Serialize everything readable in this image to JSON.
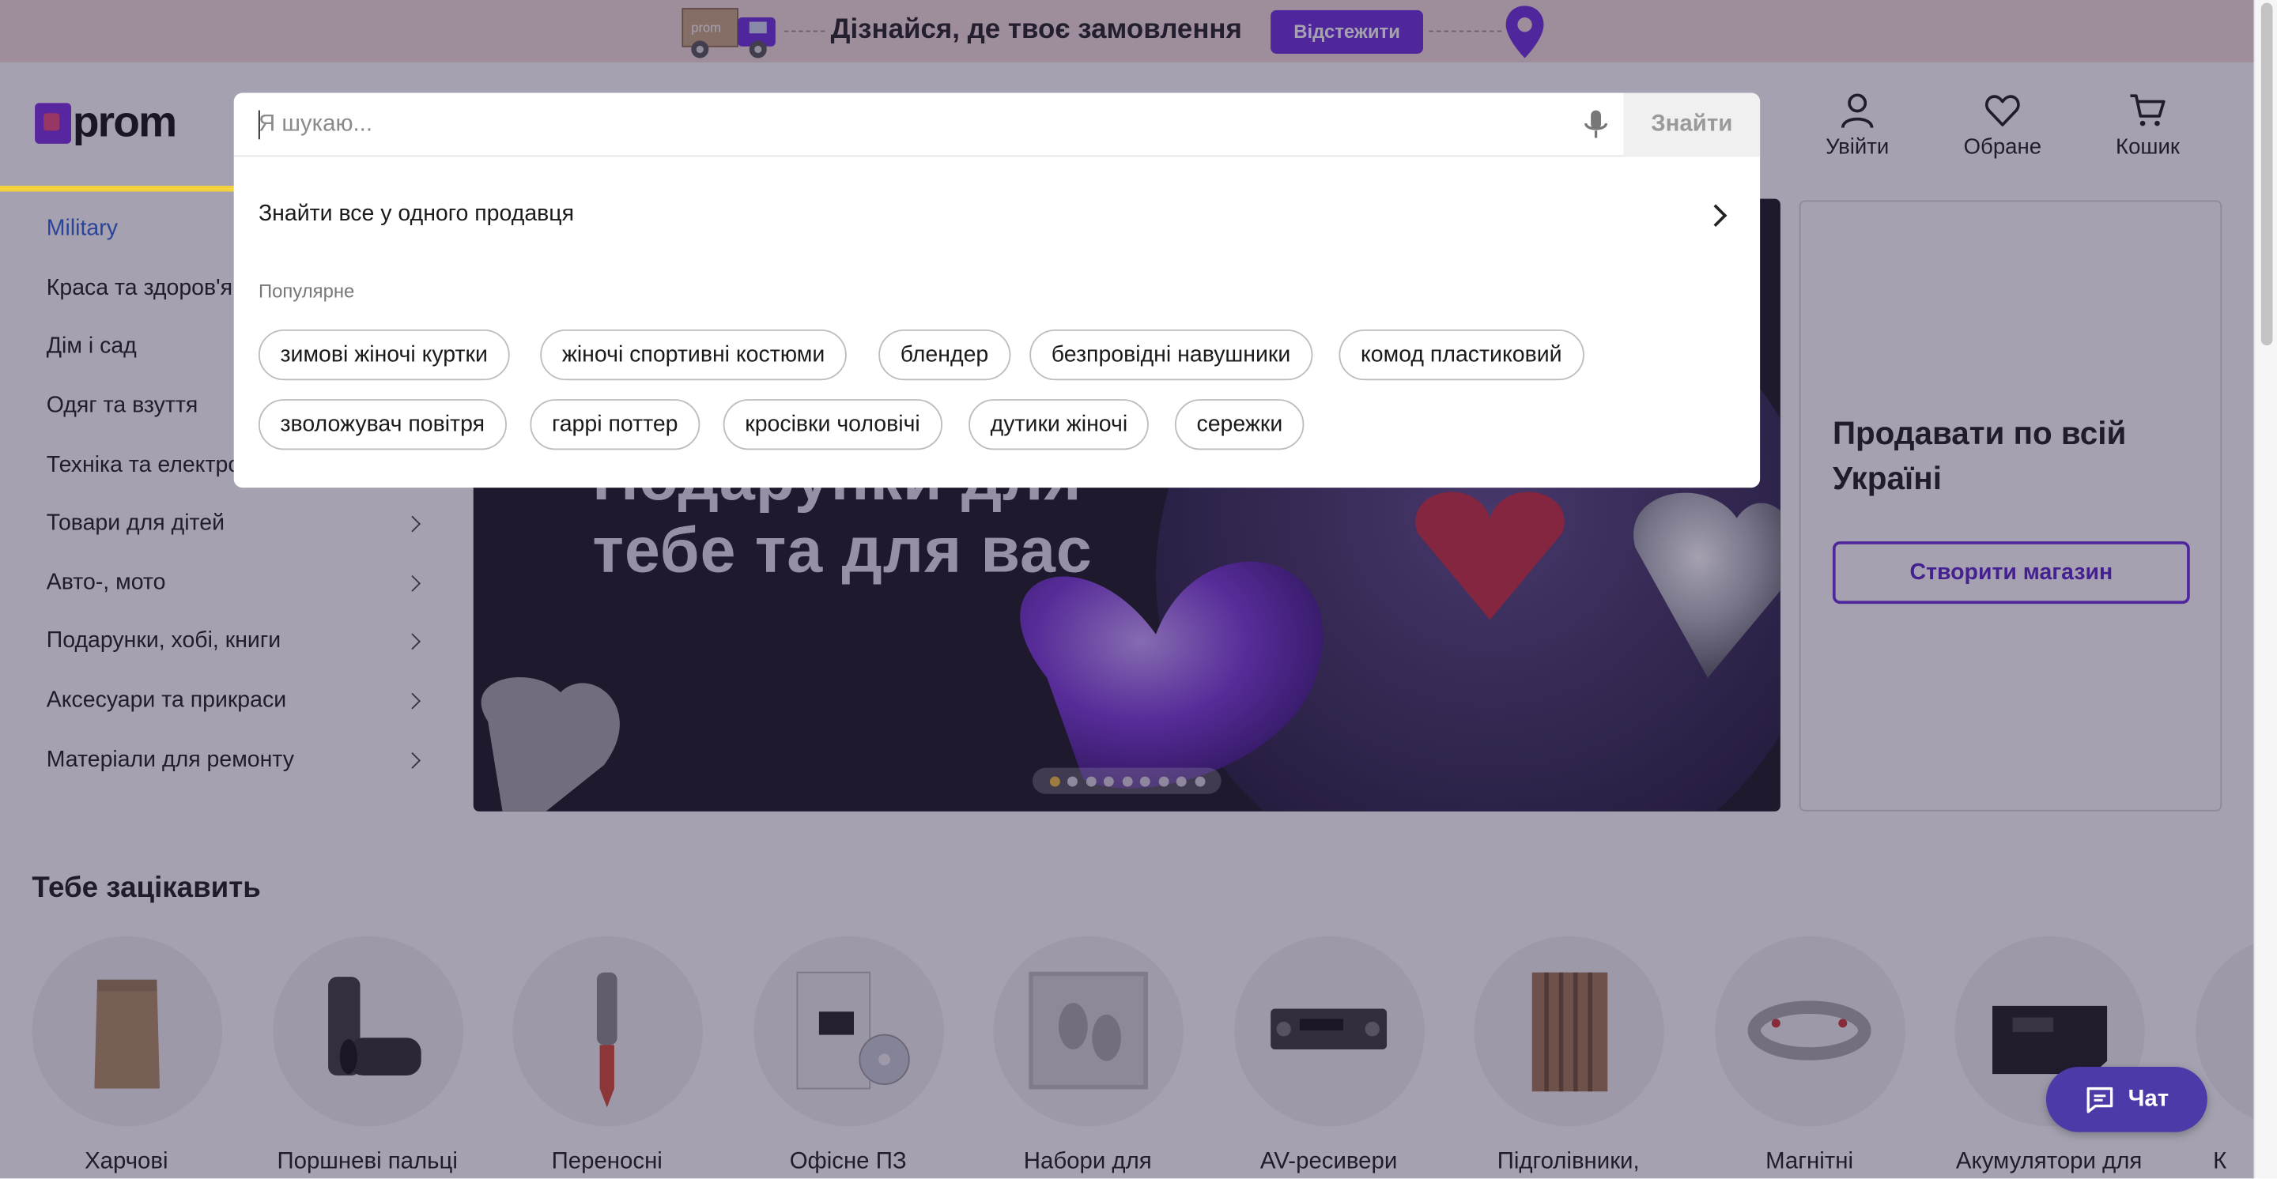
{
  "promo": {
    "truck_brand": "prom",
    "text": "Дізнайся, де твоє замовлення",
    "button": "Відстежити",
    "colors": {
      "background": "#f3ddd9",
      "button": "#6c2bd9"
    }
  },
  "header": {
    "logo": "prom",
    "actions": [
      {
        "label": "Увійти",
        "icon": "user-icon"
      },
      {
        "label": "Обране",
        "icon": "heart-icon"
      },
      {
        "label": "Кошик",
        "icon": "cart-icon"
      }
    ]
  },
  "search": {
    "placeholder": "Я шукаю...",
    "value": "",
    "button": "Знайти",
    "seller_link": "Знайти все у одного продавця",
    "popular_label": "Популярне",
    "popular": [
      "зимові жіночі куртки",
      "жіночі спортивні костюми",
      "блендер",
      "безпровідні навушники",
      "комод пластиковий",
      "зволожувач повітря",
      "гаррі поттер",
      "кросівки чоловічі",
      "дутики жіночі",
      "сережки"
    ]
  },
  "sidebar": {
    "items": [
      {
        "label": "Military",
        "active": true
      },
      {
        "label": "Краса та здоров'я"
      },
      {
        "label": "Дім і сад"
      },
      {
        "label": "Одяг та взуття"
      },
      {
        "label": "Техніка та електроніка"
      },
      {
        "label": "Товари для дітей"
      },
      {
        "label": "Авто-, мото"
      },
      {
        "label": "Подарунки, хобі, книги"
      },
      {
        "label": "Аксесуари та прикраси"
      },
      {
        "label": "Матеріали для ремонту"
      }
    ]
  },
  "hero": {
    "title_line1": "Подарунки для",
    "title_line2": "тебе та для вас",
    "slides_total": 9,
    "active_slide": 1
  },
  "sell_card": {
    "title": "Продавати по всій Україні",
    "button": "Створити магазин"
  },
  "interest": {
    "title": "Тебе зацікавить",
    "items": [
      {
        "label": "Харчові",
        "icon": "pouch-icon"
      },
      {
        "label": "Поршневі пальці",
        "icon": "piston-pin-icon"
      },
      {
        "label": "Переносні",
        "icon": "lamp-icon"
      },
      {
        "label": "Офісне ПЗ",
        "icon": "software-box-icon"
      },
      {
        "label": "Набори для",
        "icon": "handprint-kit-icon"
      },
      {
        "label": "AV-ресивери",
        "icon": "receiver-icon"
      },
      {
        "label": "Підголівники,",
        "icon": "seat-mat-icon"
      },
      {
        "label": "Магнітні",
        "icon": "bracelet-icon"
      },
      {
        "label": "Акумулятори для",
        "icon": "battery-icon"
      },
      {
        "label": "К",
        "icon": "item-icon"
      }
    ]
  },
  "chat": {
    "label": "Чат"
  },
  "colors": {
    "accent": "#6c2bd9",
    "link_active": "#2c5fd6",
    "progress": "#f3d23b",
    "chat": "#4b3aa8"
  }
}
